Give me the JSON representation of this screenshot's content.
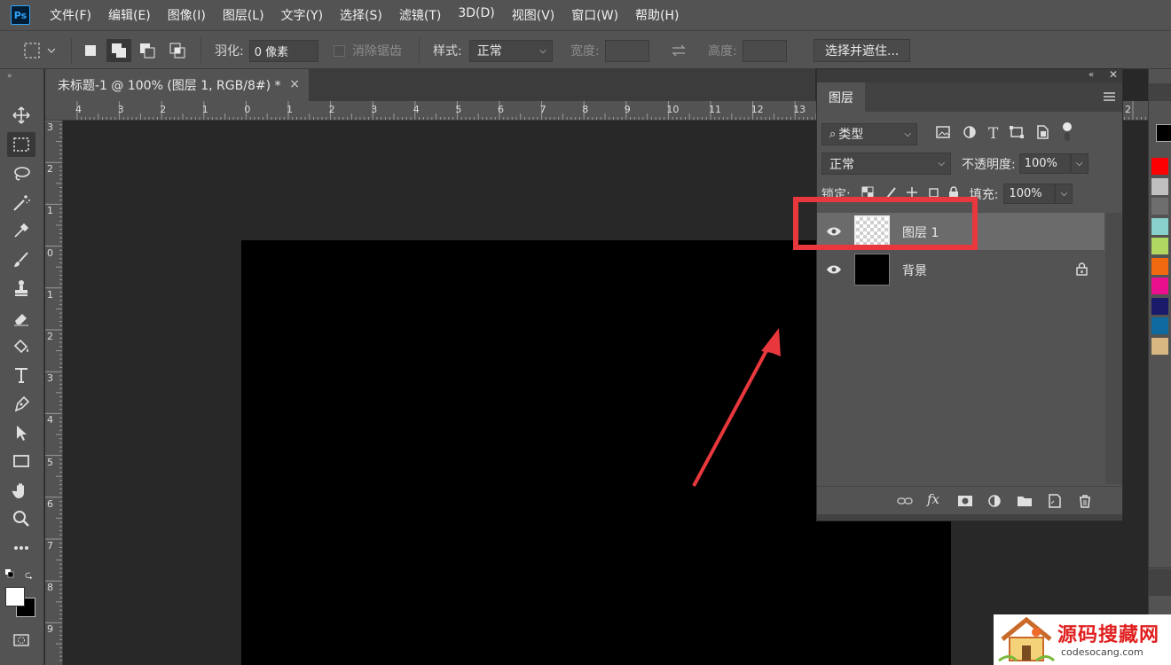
{
  "app": {
    "logo": "Ps"
  },
  "menu": [
    "文件(F)",
    "编辑(E)",
    "图像(I)",
    "图层(L)",
    "文字(Y)",
    "选择(S)",
    "滤镜(T)",
    "3D(D)",
    "视图(V)",
    "窗口(W)",
    "帮助(H)"
  ],
  "options": {
    "feather_label": "羽化:",
    "feather_value": "0 像素",
    "antialias_label": "消除锯齿",
    "style_label": "样式:",
    "style_value": "正常",
    "width_label": "宽度:",
    "height_label": "高度:",
    "select_mask_button": "选择并遮住..."
  },
  "document": {
    "tab_title": "未标题-1 @ 100% (图层 1, RGB/8#) *",
    "close_glyph": "×"
  },
  "rulers": {
    "horizontal": [
      "4",
      "3",
      "2",
      "1",
      "0",
      "1",
      "2",
      "3",
      "4",
      "5",
      "6",
      "7",
      "8",
      "9",
      "10",
      "11",
      "12",
      "13",
      "2"
    ],
    "vertical": [
      "3",
      "2",
      "1",
      "0",
      "1",
      "2",
      "3",
      "4",
      "5",
      "6",
      "7",
      "8",
      "9"
    ]
  },
  "layers_panel": {
    "title": "图层",
    "filter_label": "类型",
    "blend_mode": "正常",
    "opacity_label": "不透明度:",
    "opacity_value": "100%",
    "lock_label": "锁定:",
    "fill_label": "填充:",
    "fill_value": "100%",
    "layers": [
      {
        "name": "图层 1",
        "thumbnail": "transparent",
        "selected": true,
        "visible": true,
        "locked": false
      },
      {
        "name": "背景",
        "thumbnail": "black",
        "selected": false,
        "visible": true,
        "locked": true
      }
    ],
    "footer_icons": [
      "link-icon",
      "fx-icon",
      "mask-icon",
      "adjustment-icon",
      "folder-icon",
      "new-layer-icon",
      "trash-icon"
    ]
  },
  "swatches": [
    "#ff0000",
    "#c0c0c0",
    "#6e6e6e",
    "#88d0cc",
    "#b0d860",
    "#f26a10",
    "#ea0f8c",
    "#1b1a6a",
    "#0f6aa0",
    "#d8b880"
  ],
  "annotation": {
    "highlight_color": "#e8383d"
  },
  "watermark": {
    "title": "源码搜藏网",
    "domain": "codesocang.com"
  }
}
